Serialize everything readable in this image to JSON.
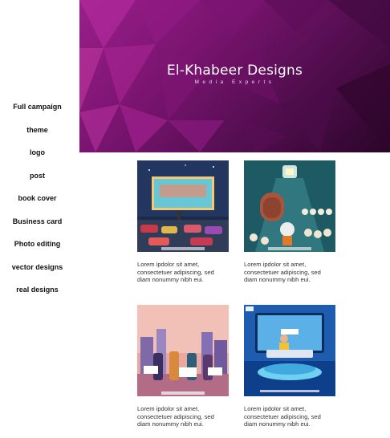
{
  "sidebar": {
    "items": [
      {
        "label": "Full campaign"
      },
      {
        "label": "theme"
      },
      {
        "label": "logo"
      },
      {
        "label": "post"
      },
      {
        "label": "book cover"
      },
      {
        "label": "Business card"
      },
      {
        "label": "Photo editing"
      },
      {
        "label": "vector designs"
      },
      {
        "label": "real designs"
      }
    ]
  },
  "banner": {
    "title": "El-Khabeer Designs",
    "subtitle": "Media Experts",
    "colors": {
      "primary": "#9a1f8a",
      "dark": "#2a0528"
    }
  },
  "gallery": {
    "items": [
      {
        "caption": "Lorem ipdolor sit amet, consectetuer adipiscing, sed diam nonummy nibh eui.",
        "image": "drive-in-cinema-illustration"
      },
      {
        "caption": "Lorem ipdolor sit amet, consectetuer adipiscing, sed diam nonummy nibh eui.",
        "image": "astronaut-skulls-illustration"
      },
      {
        "caption": "Lorem ipdolor sit amet, consectetuer adipiscing, sed diam nonummy nibh eui.",
        "image": "street-protest-illustration"
      },
      {
        "caption": "Lorem ipdolor sit amet, consectetuer adipiscing, sed diam nonummy nibh eui.",
        "image": "news-studio-illustration"
      }
    ]
  }
}
